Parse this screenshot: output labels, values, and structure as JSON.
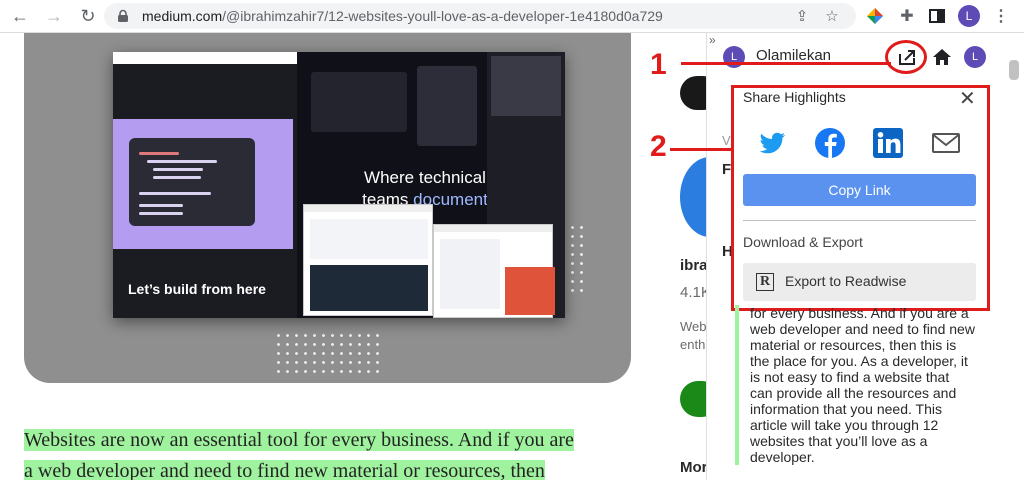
{
  "browser": {
    "url_host": "medium.com",
    "url_path": "/@ibrahimzahir7/12-websites-youll-love-as-a-developer-1e4180d0a729",
    "profile_initial": "L"
  },
  "hero": {
    "headline_line1": "Where technical",
    "headline_line2_plain": "teams ",
    "headline_line2_accent": "document",
    "lets_build": "Let’s build from here"
  },
  "article": {
    "paragraph_line1": "Websites are now an essential tool for every business. And if you are",
    "paragraph_line2": "a web developer and need to find new material or resources, then"
  },
  "sidebar_bg": {
    "author_prefix": "ibra",
    "followers": "4.1K",
    "bio_line1": "Web",
    "bio_line2": "enth",
    "more": "Mor",
    "letter_f": "F",
    "letter_h": "H",
    "letter_v": "V"
  },
  "extension": {
    "user_name": "Olamilekan",
    "user_initial": "L",
    "share_highlights": "Share Highlights",
    "copy_link": "Copy Link",
    "download_export": "Download & Export",
    "export_readwise": "Export to Readwise",
    "highlight": "for every business. And if you are a web developer and need to find new material or resources, then this is the place for you. As a developer, it is not easy to find a website that can provide all the resources and information that you need. This article will take you through 12 websites that you’ll love as a developer."
  },
  "annotations": {
    "one": "1",
    "two": "2"
  },
  "colors": {
    "annotation_red": "#e01b1b",
    "copy_link_blue": "#5b92f0",
    "highlight_green": "#9ff29e",
    "twitter": "#1d9bf0",
    "facebook": "#1877f2",
    "linkedin": "#0a66c2"
  }
}
